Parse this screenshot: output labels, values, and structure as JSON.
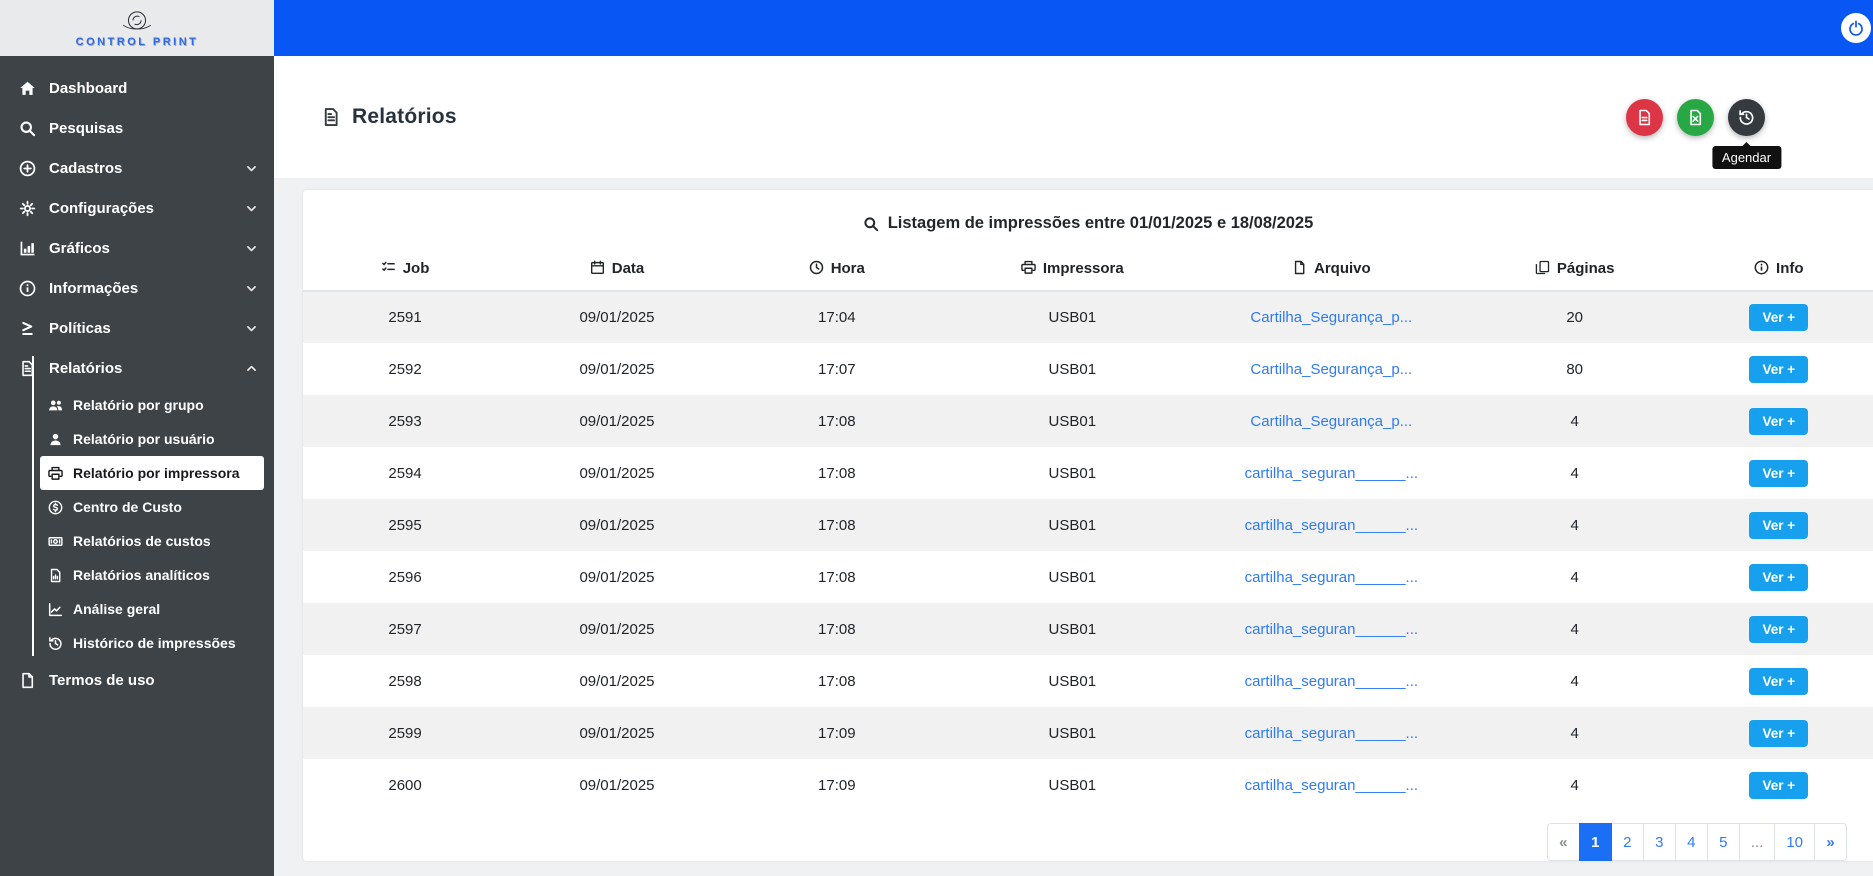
{
  "brand": {
    "name": "CONTROL PRINT"
  },
  "colors": {
    "topbar": "#0857f5",
    "sidebar": "#3e4347",
    "link": "#2e7bf6",
    "info_button": "#17a0ee",
    "pagination_active": "#1a6ff5",
    "pdf_button": "#dc3545",
    "excel_button": "#28a745",
    "schedule_button": "#343a40"
  },
  "sidebar": {
    "items": [
      {
        "label": "Dashboard",
        "icon": "home"
      },
      {
        "label": "Pesquisas",
        "icon": "search"
      },
      {
        "label": "Cadastros",
        "icon": "plus-circle",
        "chevron": "down"
      },
      {
        "label": "Configurações",
        "icon": "gears",
        "chevron": "down"
      },
      {
        "label": "Gráficos",
        "icon": "chart",
        "chevron": "down"
      },
      {
        "label": "Informações",
        "icon": "info",
        "chevron": "down"
      },
      {
        "label": "Políticas",
        "icon": "policies",
        "chevron": "down"
      },
      {
        "label": "Relatórios",
        "icon": "report",
        "chevron": "up",
        "active": true,
        "group": "relatorios"
      }
    ],
    "relatorios_submenu": [
      {
        "label": "Relatório por grupo",
        "icon": "users"
      },
      {
        "label": "Relatório por usuário",
        "icon": "user"
      },
      {
        "label": "Relatório por impressora",
        "icon": "printer",
        "active": true
      },
      {
        "label": "Centro de Custo",
        "icon": "money"
      },
      {
        "label": "Relatórios de custos",
        "icon": "money-bill"
      },
      {
        "label": "Relatórios analíticos",
        "icon": "file-chart"
      },
      {
        "label": "Análise geral",
        "icon": "chart-line"
      },
      {
        "label": "Histórico de impressões",
        "icon": "history"
      }
    ],
    "bottom_items": [
      {
        "label": "Termos de uso",
        "icon": "file"
      }
    ]
  },
  "header": {
    "title": "Relatórios"
  },
  "actions": {
    "schedule_tooltip": "Agendar"
  },
  "table": {
    "caption": "Listagem de impressões entre 01/01/2025 e 18/08/2025",
    "columns": [
      {
        "label": "Job",
        "icon": "tasks"
      },
      {
        "label": "Data",
        "icon": "calendar"
      },
      {
        "label": "Hora",
        "icon": "clock"
      },
      {
        "label": "Impressora",
        "icon": "printer"
      },
      {
        "label": "Arquivo",
        "icon": "file"
      },
      {
        "label": "Páginas",
        "icon": "copy"
      },
      {
        "label": "Info",
        "icon": "info"
      }
    ],
    "info_button_label": "Ver +",
    "rows": [
      {
        "job": "2591",
        "data": "09/01/2025",
        "hora": "17:04",
        "impressora": "USB01",
        "arquivo": "Cartilha_Segurança_p...",
        "paginas": "20"
      },
      {
        "job": "2592",
        "data": "09/01/2025",
        "hora": "17:07",
        "impressora": "USB01",
        "arquivo": "Cartilha_Segurança_p...",
        "paginas": "80"
      },
      {
        "job": "2593",
        "data": "09/01/2025",
        "hora": "17:08",
        "impressora": "USB01",
        "arquivo": "Cartilha_Segurança_p...",
        "paginas": "4"
      },
      {
        "job": "2594",
        "data": "09/01/2025",
        "hora": "17:08",
        "impressora": "USB01",
        "arquivo": "cartilha_seguran______...",
        "paginas": "4"
      },
      {
        "job": "2595",
        "data": "09/01/2025",
        "hora": "17:08",
        "impressora": "USB01",
        "arquivo": "cartilha_seguran______...",
        "paginas": "4"
      },
      {
        "job": "2596",
        "data": "09/01/2025",
        "hora": "17:08",
        "impressora": "USB01",
        "arquivo": "cartilha_seguran______...",
        "paginas": "4"
      },
      {
        "job": "2597",
        "data": "09/01/2025",
        "hora": "17:08",
        "impressora": "USB01",
        "arquivo": "cartilha_seguran______...",
        "paginas": "4"
      },
      {
        "job": "2598",
        "data": "09/01/2025",
        "hora": "17:08",
        "impressora": "USB01",
        "arquivo": "cartilha_seguran______...",
        "paginas": "4"
      },
      {
        "job": "2599",
        "data": "09/01/2025",
        "hora": "17:09",
        "impressora": "USB01",
        "arquivo": "cartilha_seguran______...",
        "paginas": "4"
      },
      {
        "job": "2600",
        "data": "09/01/2025",
        "hora": "17:09",
        "impressora": "USB01",
        "arquivo": "cartilha_seguran______...",
        "paginas": "4"
      }
    ]
  },
  "pagination": {
    "first": "«",
    "last": "»",
    "pages": [
      "1",
      "2",
      "3",
      "4",
      "5",
      "...",
      "10"
    ],
    "active_page": "1"
  }
}
